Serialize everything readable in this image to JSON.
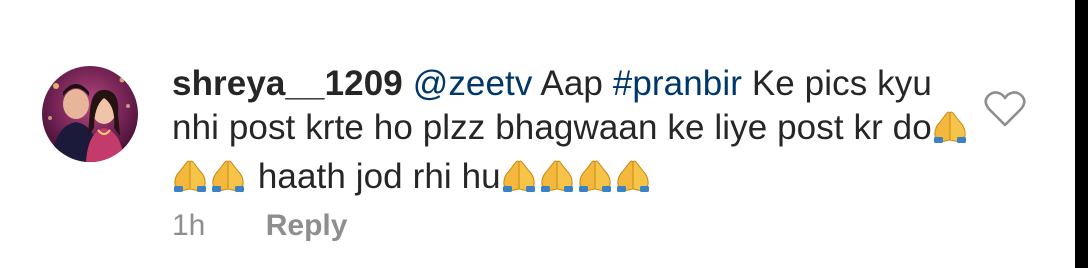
{
  "comment": {
    "username": "shreya__1209",
    "mention": "@zeetv",
    "text_1": " Aap ",
    "hashtag": "#pranbir",
    "text_2": " Ke pics kyu nhi post krte ho plzz bhagwaan ke liye post kr do",
    "text_3": " haath jod rhi hu",
    "emoji_group_1_count": 3,
    "emoji_group_2_count": 4,
    "emoji_icon": "folded-hands-icon",
    "timestamp": "1h",
    "reply_label": "Reply",
    "like_icon": "heart-outline-icon"
  },
  "colors": {
    "text": "#262626",
    "link": "#00376b",
    "meta": "#8e8e8e",
    "heart_outline": "#8e8e8e"
  }
}
